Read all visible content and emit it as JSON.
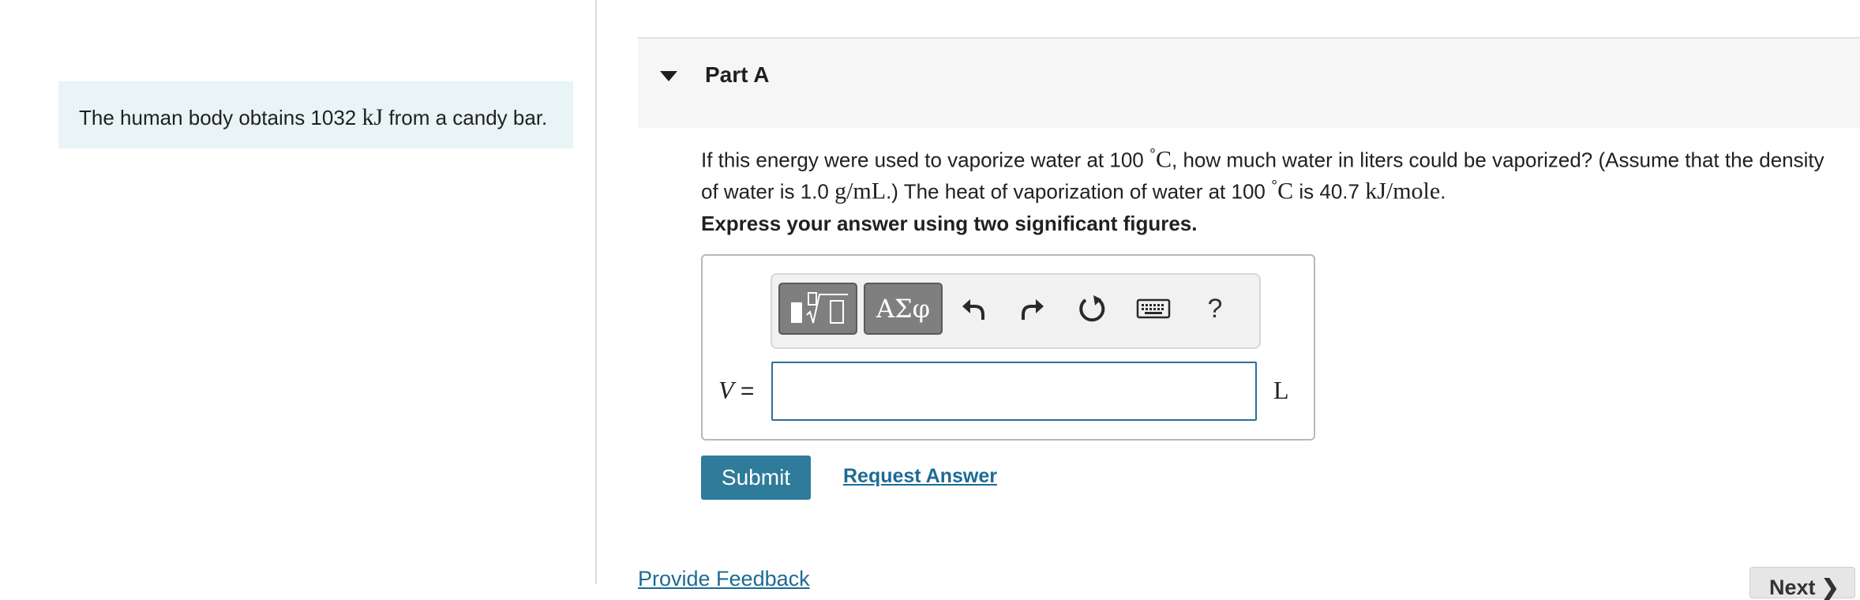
{
  "intro": {
    "text_before": "The human body obtains 1032 ",
    "unit": "kJ",
    "text_after": " from a candy bar."
  },
  "part": {
    "title": "Part A",
    "expanded": true
  },
  "question": {
    "line1_a": "If this energy were used to vaporize water at 100 ",
    "line1_deg": "°",
    "line1_c": "C",
    "line1_b": ", how much water in liters could be vaporized? (Assume that the density",
    "line2_a": "of water is 1.0 ",
    "line2_density_unit": "g/mL",
    "line2_b": ".) The heat of vaporization of water at 100 ",
    "line2_deg": "°",
    "line2_c": "C",
    "line2_d": " is 40.7 ",
    "line2_unit": "kJ/mole",
    "line2_e": "."
  },
  "instruction": "Express your answer using two significant figures.",
  "toolbar": {
    "templates_icon": "fraction-sqrt-icon",
    "greek_label": "ΑΣφ",
    "undo_icon": "undo-icon",
    "redo_icon": "redo-icon",
    "reset_icon": "reset-icon",
    "keyboard_icon": "keyboard-icon",
    "help_label": "?"
  },
  "answer": {
    "variable": "V",
    "equals": "=",
    "value": "",
    "unit": "L"
  },
  "actions": {
    "submit_label": "Submit",
    "request_answer_label": "Request Answer",
    "feedback_label": "Provide Feedback",
    "next_label": "Next ❯"
  },
  "colors": {
    "intro_bg": "#e8f4f6",
    "primary": "#2e7b9a",
    "link": "#1d6b95",
    "input_border": "#2c6f96"
  }
}
